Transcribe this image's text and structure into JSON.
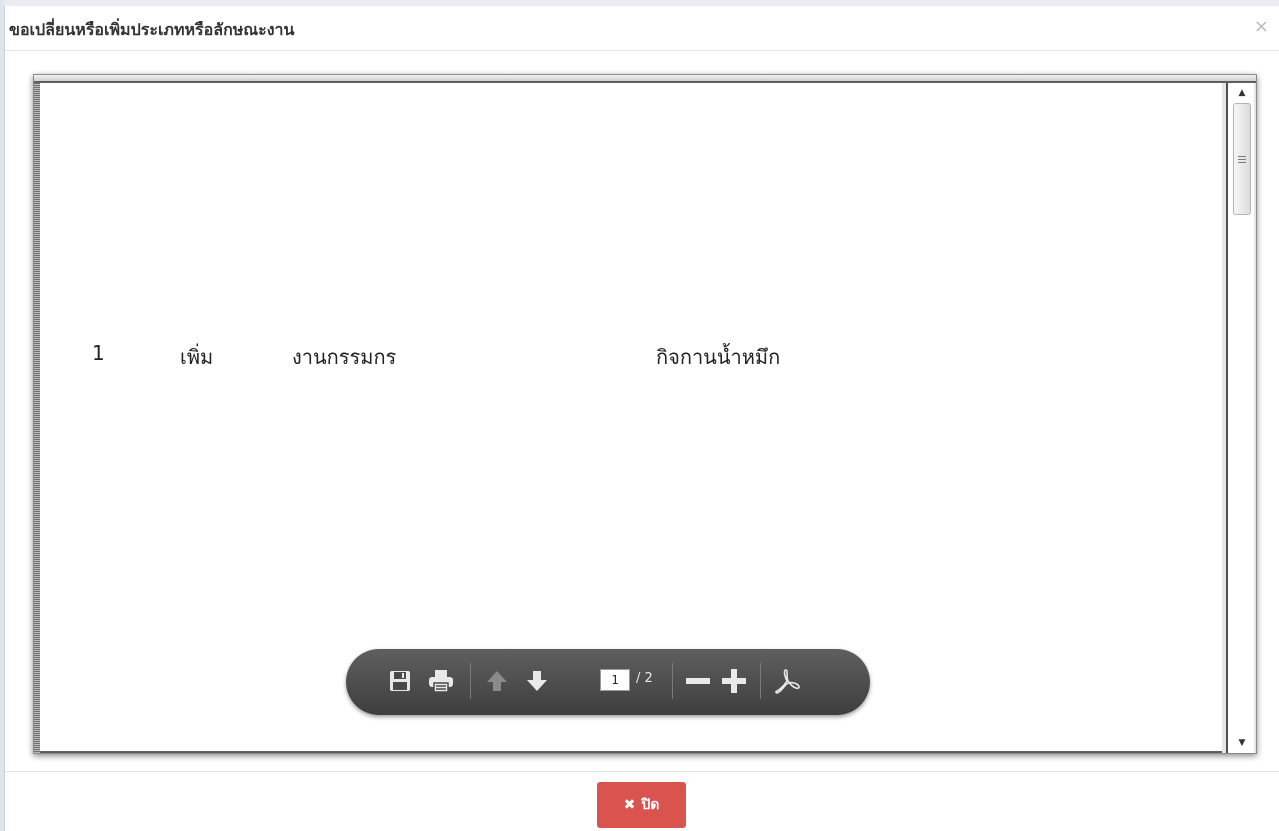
{
  "dialog": {
    "title": "ขอเปลี่ยนหรือเพิ่มประเภทหรือลักษณะงาน",
    "close_icon": "×"
  },
  "pdf": {
    "rows": [
      {
        "number": "1",
        "action": "เพิ่ม",
        "type": "งานกรรมกร",
        "description": "กิจกานน้ำหมึก"
      }
    ],
    "toolbar": {
      "icons": [
        "save-icon",
        "print-icon",
        "previous-page-icon",
        "next-page-icon",
        "zoom-out-icon",
        "zoom-in-icon",
        "acrobat-icon"
      ],
      "current_page": "1",
      "total_pages": "/ 2"
    }
  },
  "footer": {
    "close_label": "ปิด",
    "close_icon": "✖",
    "close_color": "#d9534f"
  }
}
